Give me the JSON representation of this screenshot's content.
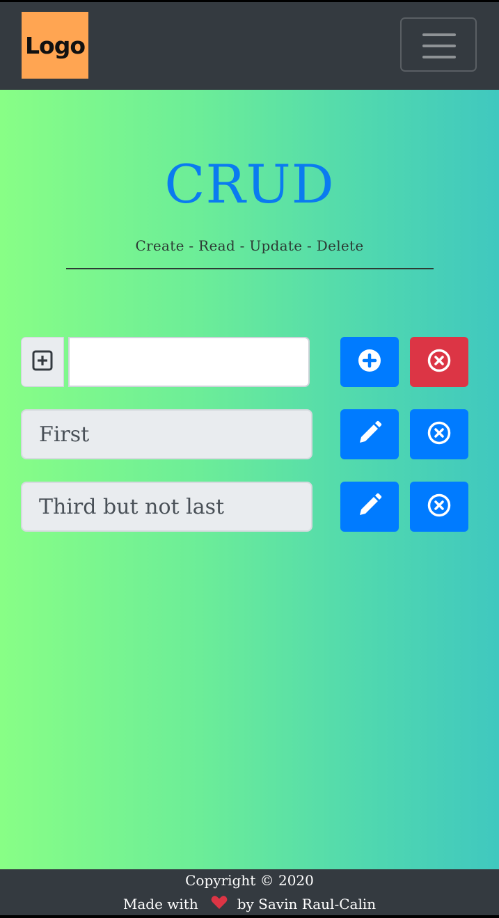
{
  "navbar": {
    "logo_text": "Logo",
    "toggler_icon": "hamburger-menu-icon"
  },
  "header": {
    "title": "CRUD",
    "subtitle": "Create - Read - Update - Delete"
  },
  "new_item": {
    "prepend_icon": "plus-square-icon",
    "value": "",
    "add_icon": "plus-circle-icon",
    "clear_icon": "x-circle-icon"
  },
  "items": [
    {
      "value": "First",
      "edit_icon": "pencil-icon",
      "delete_icon": "x-circle-icon"
    },
    {
      "value": "Third but not last",
      "edit_icon": "pencil-icon",
      "delete_icon": "x-circle-icon"
    }
  ],
  "footer": {
    "copyright": "Copyright © 2020",
    "made_with": "Made with",
    "heart_icon": "heart-icon",
    "author": "by Savin Raul-Calin"
  },
  "colors": {
    "navbar": "#343a40",
    "logo": "#ffa552",
    "title": "#0a7bf0",
    "primary": "#007bff",
    "danger": "#dc3545",
    "heart": "#dc3545",
    "gradient_start": "#88fe86",
    "gradient_end": "#40c8bf"
  }
}
